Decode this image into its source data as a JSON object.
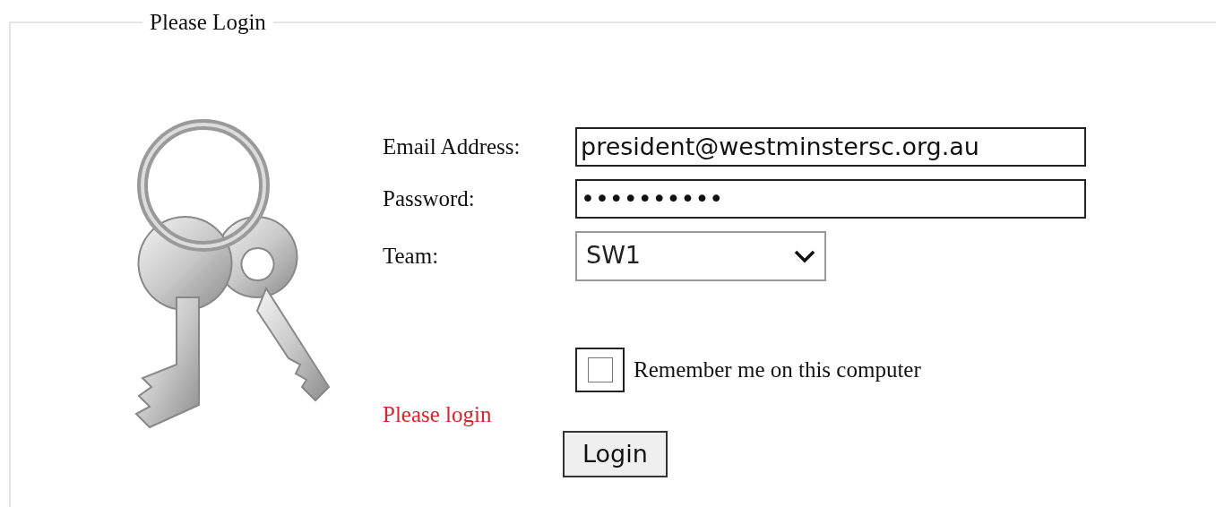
{
  "panel": {
    "legend": "Please Login"
  },
  "fields": [
    {
      "label": "Email Address:",
      "value": "president@westminstersc.org.au"
    },
    {
      "label": "Password:",
      "value": "••••••••••"
    }
  ],
  "team": {
    "label": "Team:",
    "value": "SW1"
  },
  "remember": {
    "label": "Remember me on this computer",
    "checked": false
  },
  "message": "Please login",
  "login_button": "Login"
}
